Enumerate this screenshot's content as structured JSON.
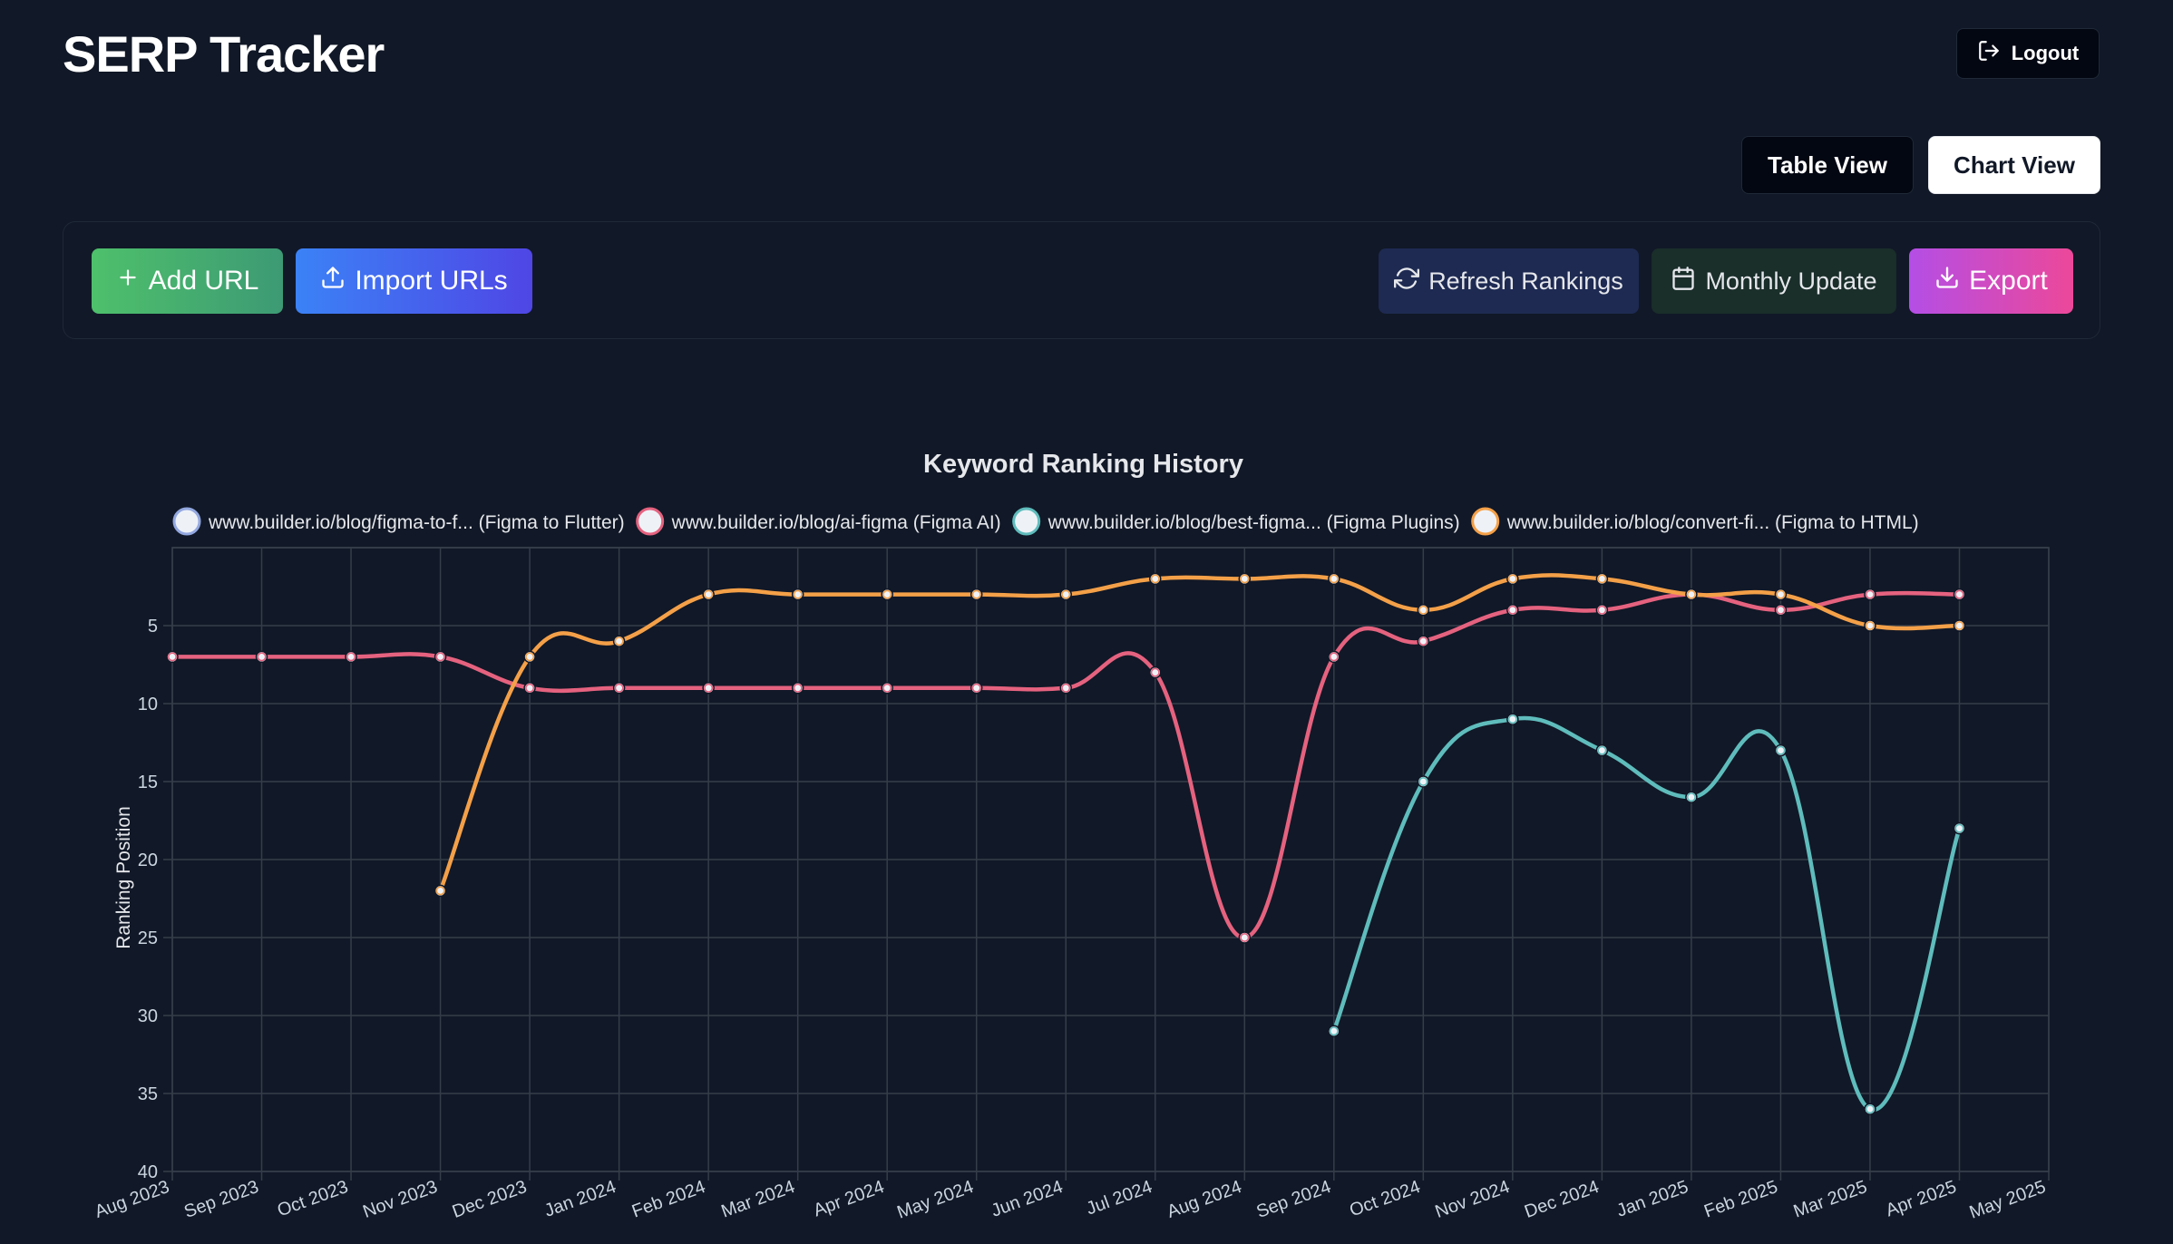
{
  "header": {
    "title": "SERP Tracker",
    "logout_label": "Logout"
  },
  "view_toggle": {
    "table_label": "Table View",
    "chart_label": "Chart View",
    "selected": "chart"
  },
  "toolbar": {
    "add_url_label": "Add URL",
    "import_urls_label": "Import URLs",
    "refresh_label": "Refresh Rankings",
    "monthly_label": "Monthly Update",
    "export_label": "Export"
  },
  "icons": {
    "logout": "logout-icon",
    "add": "plus-icon",
    "import": "upload-icon",
    "refresh": "refresh-icon",
    "monthly": "calendar-icon",
    "export": "download-icon"
  },
  "chart_data": {
    "type": "line",
    "title": "Keyword Ranking History",
    "xlabel": "",
    "ylabel": "Ranking Position",
    "y_reversed": true,
    "ylim": [
      0,
      40
    ],
    "yticks": [
      5,
      10,
      15,
      20,
      25,
      30,
      35,
      40
    ],
    "grid": true,
    "legend": "top",
    "categories": [
      "Aug 2023",
      "Sep 2023",
      "Oct 2023",
      "Nov 2023",
      "Dec 2023",
      "Jan 2024",
      "Feb 2024",
      "Mar 2024",
      "Apr 2024",
      "May 2024",
      "Jun 2024",
      "Jul 2024",
      "Aug 2024",
      "Sep 2024",
      "Oct 2024",
      "Nov 2024",
      "Dec 2024",
      "Jan 2025",
      "Feb 2025",
      "Mar 2025",
      "Apr 2025",
      "May 2025"
    ],
    "series": [
      {
        "name": "www.builder.io/blog/figma-to-f... (Figma to Flutter)",
        "color": "#93a8e0",
        "values": [
          null,
          null,
          null,
          null,
          null,
          null,
          null,
          null,
          null,
          null,
          null,
          null,
          null,
          null,
          null,
          null,
          null,
          null,
          null,
          null,
          5,
          null
        ]
      },
      {
        "name": "www.builder.io/blog/ai-figma (Figma AI)",
        "color": "#e5627f",
        "values": [
          7,
          7,
          7,
          7,
          9,
          9,
          9,
          9,
          9,
          9,
          9,
          8,
          25,
          7,
          6,
          4,
          4,
          3,
          4,
          3,
          3,
          null
        ]
      },
      {
        "name": "www.builder.io/blog/best-figma... (Figma Plugins)",
        "color": "#5fbcbc",
        "values": [
          null,
          null,
          null,
          null,
          null,
          null,
          null,
          null,
          null,
          null,
          null,
          null,
          null,
          31,
          15,
          11,
          13,
          16,
          13,
          36,
          18,
          null
        ]
      },
      {
        "name": "www.builder.io/blog/convert-fi... (Figma to HTML)",
        "color": "#f4a048",
        "values": [
          null,
          null,
          null,
          22,
          7,
          6,
          3,
          3,
          3,
          3,
          3,
          2,
          2,
          2,
          4,
          2,
          2,
          3,
          3,
          5,
          5,
          null
        ]
      }
    ]
  }
}
